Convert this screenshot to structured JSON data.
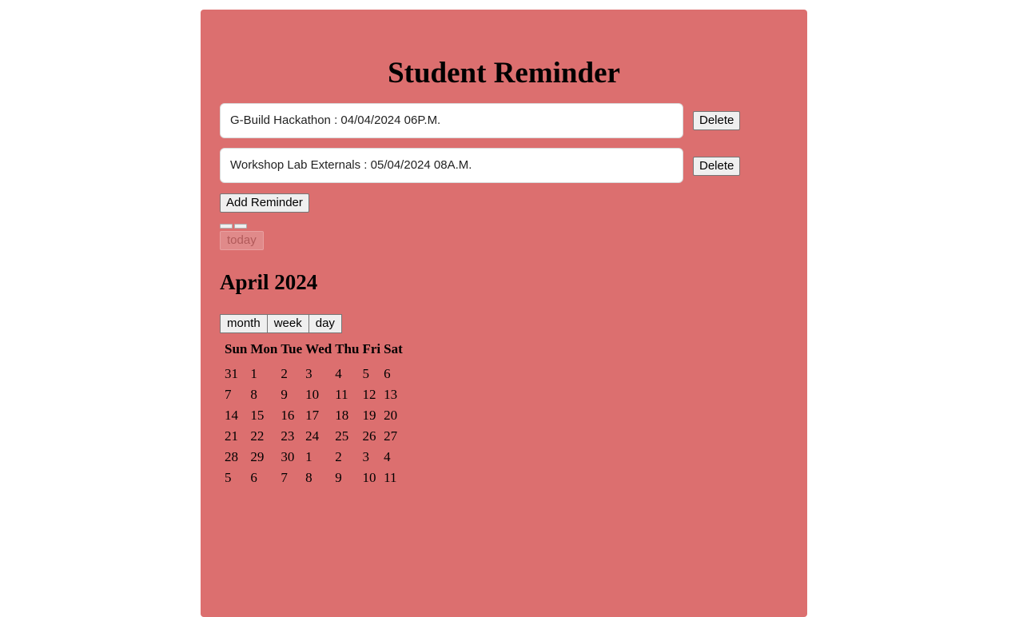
{
  "app": {
    "title": "Student Reminder"
  },
  "reminders": [
    {
      "text": "G-Build Hackathon : 04/04/2024 06P.M.",
      "delete_label": "Delete"
    },
    {
      "text": "Workshop Lab Externals : 05/04/2024 08A.M.",
      "delete_label": "Delete"
    }
  ],
  "add_button": {
    "label": "Add Reminder"
  },
  "calendar": {
    "today_label": "today",
    "title": "April 2024",
    "views": [
      "month",
      "week",
      "day"
    ],
    "weekdays": [
      "Sun",
      "Mon",
      "Tue",
      "Wed",
      "Thu",
      "Fri",
      "Sat"
    ],
    "weeks": [
      [
        "31",
        "1",
        "2",
        "3",
        "4",
        "5",
        "6"
      ],
      [
        "7",
        "8",
        "9",
        "10",
        "11",
        "12",
        "13"
      ],
      [
        "14",
        "15",
        "16",
        "17",
        "18",
        "19",
        "20"
      ],
      [
        "21",
        "22",
        "23",
        "24",
        "25",
        "26",
        "27"
      ],
      [
        "28",
        "29",
        "30",
        "1",
        "2",
        "3",
        "4"
      ],
      [
        "5",
        "6",
        "7",
        "8",
        "9",
        "10",
        "11"
      ]
    ]
  },
  "colors": {
    "card_background": "#dc6f6f",
    "page_background": "#ffffff"
  }
}
